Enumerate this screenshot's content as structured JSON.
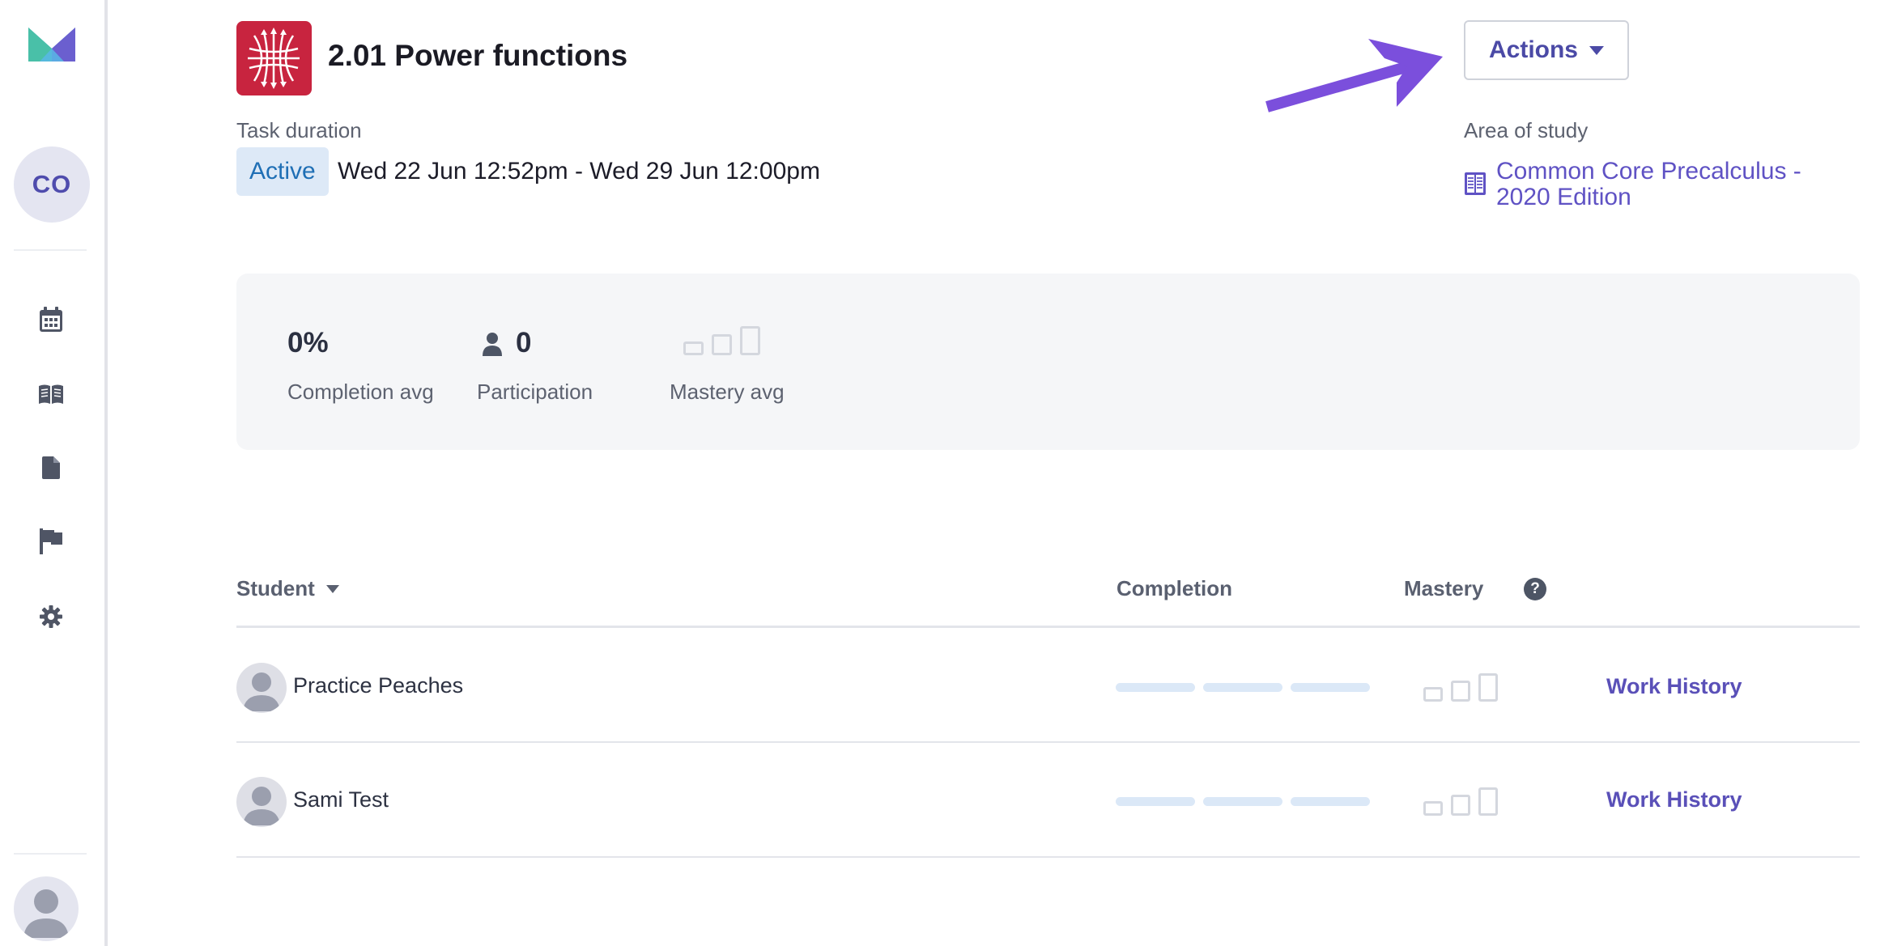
{
  "sidebar": {
    "course_initials": "CO",
    "nav": [
      {
        "name": "calendar-icon"
      },
      {
        "name": "book-open-icon"
      },
      {
        "name": "document-icon"
      },
      {
        "name": "flag-icon"
      },
      {
        "name": "gear-icon"
      }
    ]
  },
  "header": {
    "title": "2.01 Power functions",
    "task_duration_label": "Task duration",
    "status": "Active",
    "duration_range": "Wed 22 Jun 12:52pm - Wed 29 Jun 12:00pm",
    "actions_label": "Actions",
    "area_of_study_label": "Area of study",
    "area_of_study_line1": "Common Core Precalculus -",
    "area_of_study_line2": "2020 Edition"
  },
  "stats": {
    "completion_value": "0%",
    "completion_label": "Completion avg",
    "participation_value": "0",
    "participation_label": "Participation",
    "mastery_label": "Mastery avg"
  },
  "table": {
    "headers": {
      "student": "Student",
      "completion": "Completion",
      "mastery": "Mastery",
      "help": "?"
    },
    "rows": [
      {
        "name": "Practice Peaches",
        "completion_pct": 0,
        "mastery_level": 0,
        "action": "Work History"
      },
      {
        "name": "Sami Test",
        "completion_pct": 0,
        "mastery_level": 0,
        "action": "Work History"
      }
    ]
  },
  "colors": {
    "accent": "#4b4aa6",
    "link": "#5f52c4",
    "badge_bg": "#dde9f7",
    "badge_text": "#1f6fb5",
    "task_icon_bg": "#c8243f",
    "annotation_arrow": "#7b4fdc"
  }
}
